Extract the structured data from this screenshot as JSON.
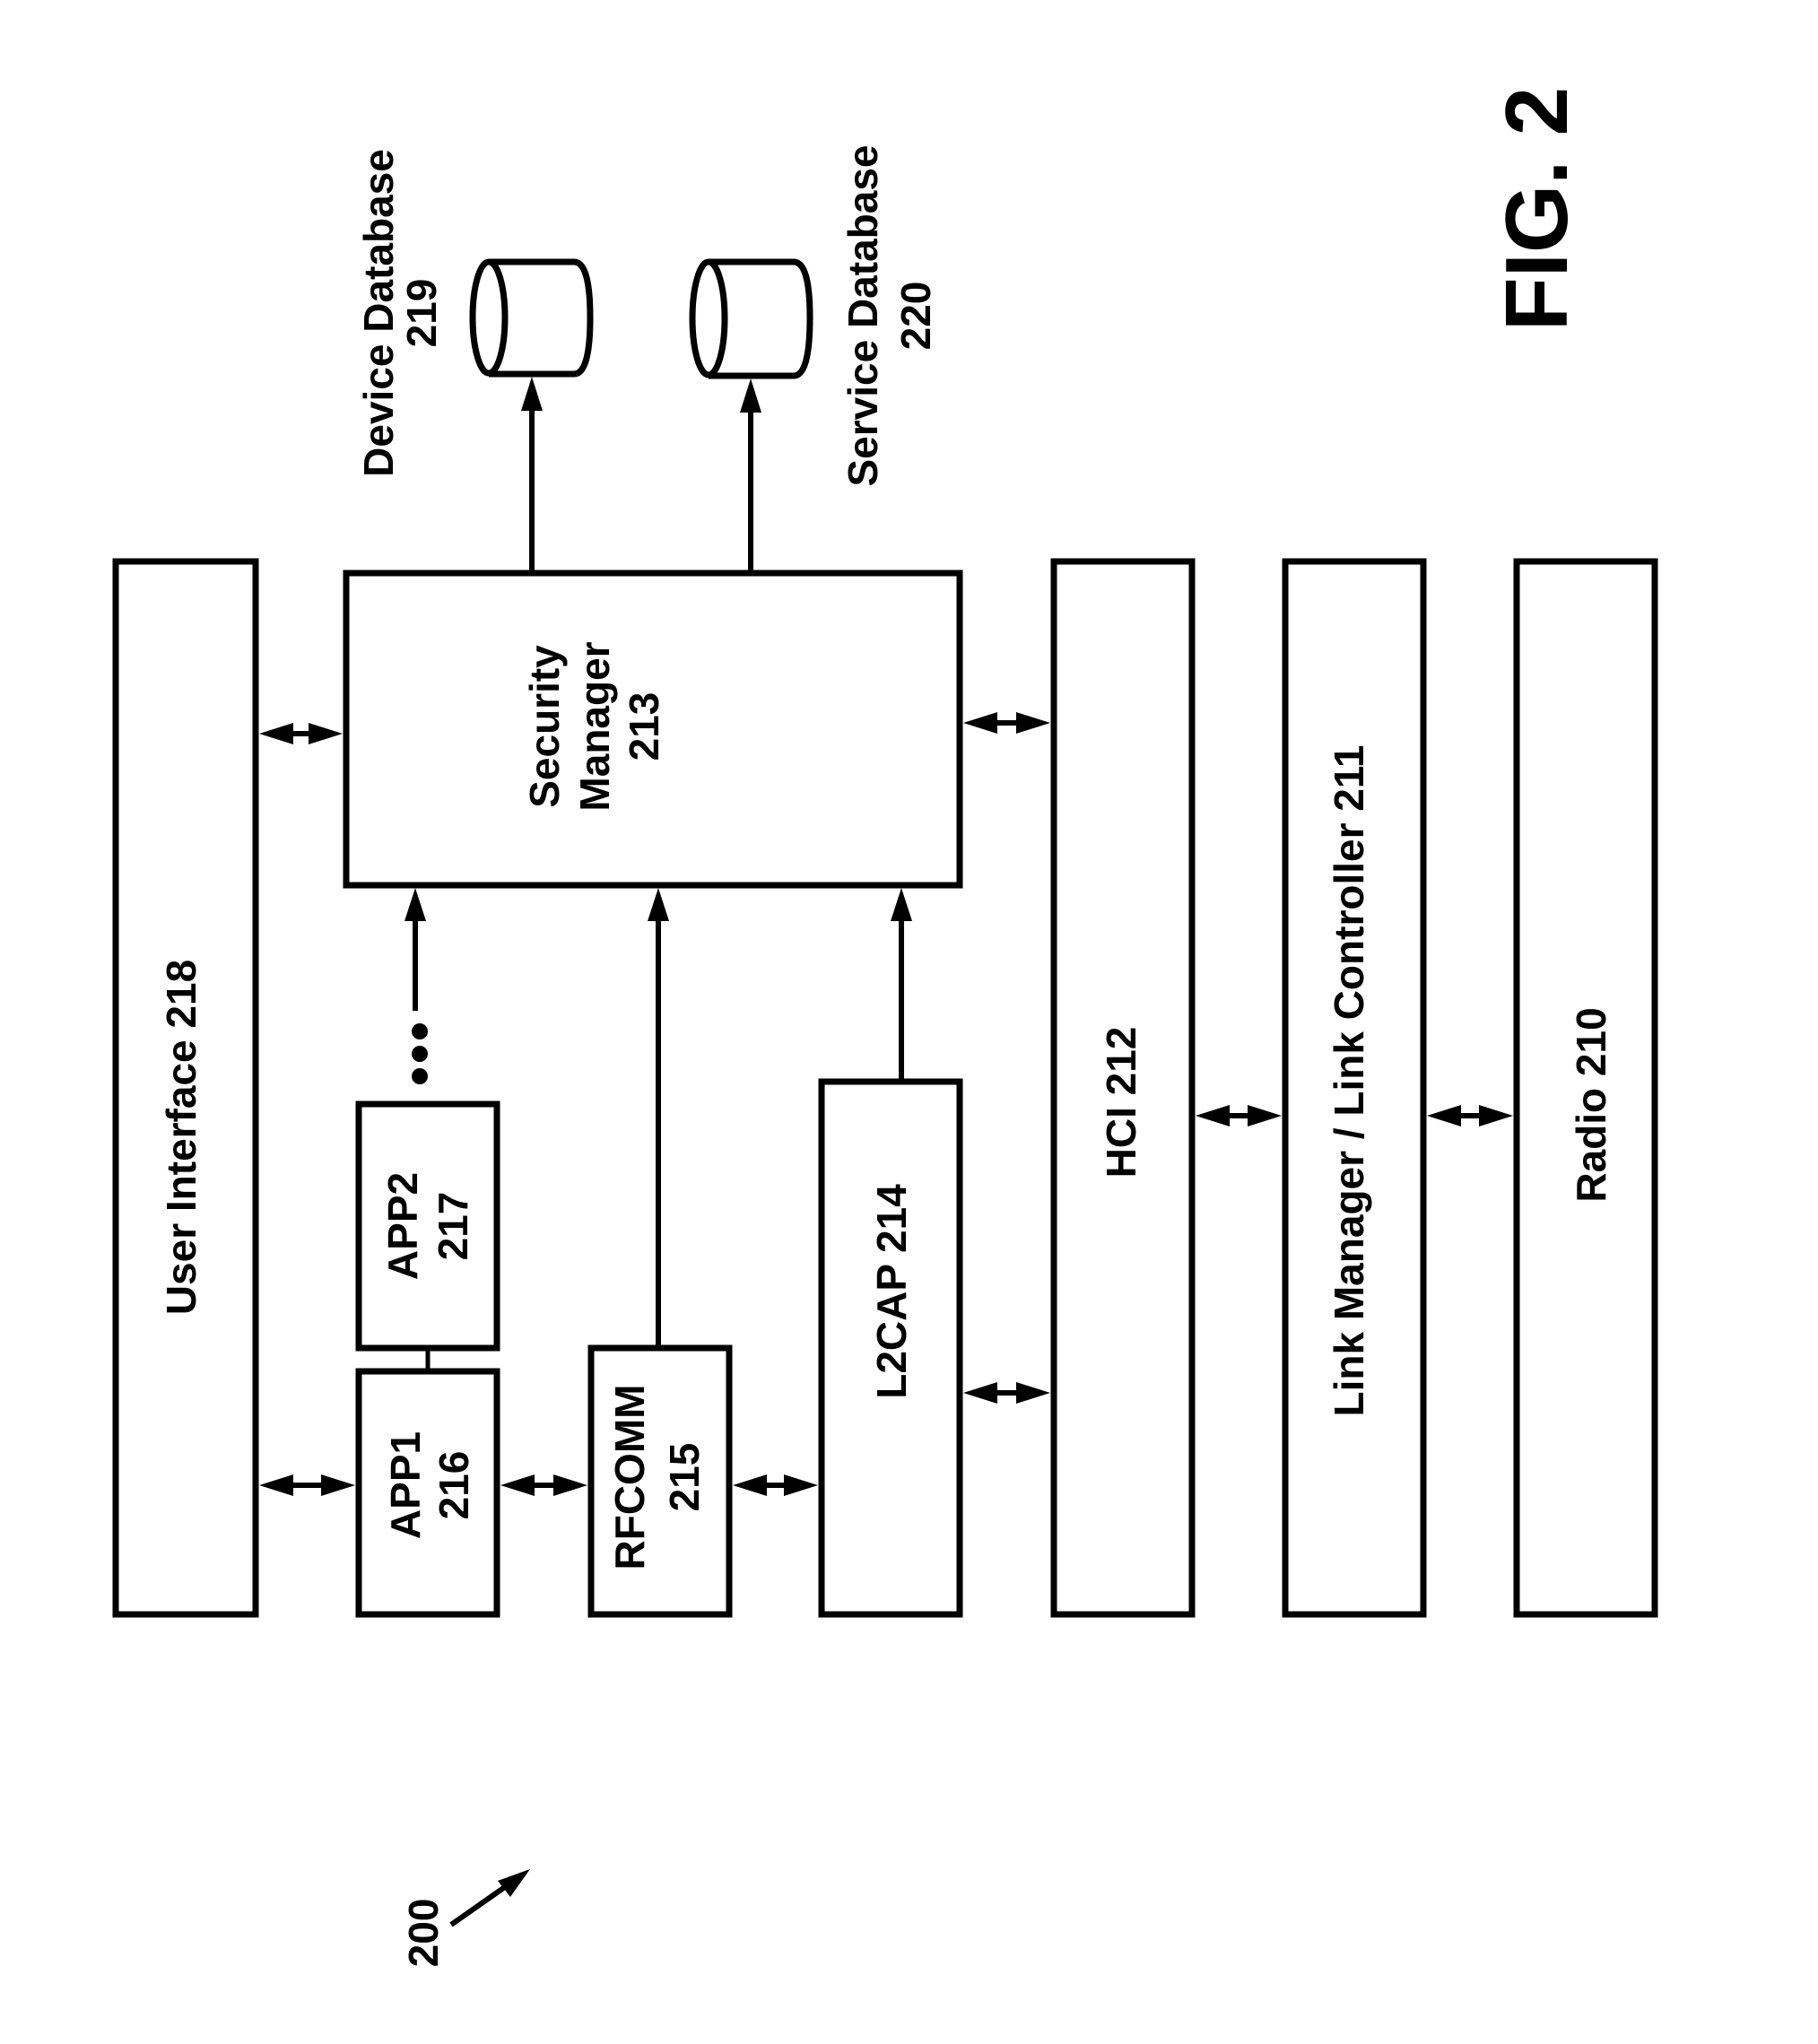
{
  "figure": {
    "title": "FIG. 2",
    "reference_number": "200"
  },
  "blocks": {
    "user_interface": {
      "name": "User Interface",
      "ref": "218",
      "label": "User Interface 218"
    },
    "security_manager": {
      "line1": "Security",
      "line2": "Manager",
      "line3": "213"
    },
    "app1": {
      "line1": "APP1",
      "line2": "216"
    },
    "app2": {
      "line1": "APP2",
      "line2": "217"
    },
    "rfcomm": {
      "line1": "RFCOMM",
      "line2": "215"
    },
    "l2cap": {
      "label": "L2CAP 214"
    },
    "hci": {
      "label": "HCI 212"
    },
    "link_manager": {
      "label": "Link Manager / Link Controller 211"
    },
    "radio": {
      "label": "Radio 210"
    }
  },
  "databases": {
    "device": {
      "line1": "Device Database",
      "line2": "219"
    },
    "service": {
      "line1": "Service Database",
      "line2": "220"
    }
  },
  "connections": [
    {
      "from": "user_interface",
      "to": "security_manager",
      "type": "bidirectional"
    },
    {
      "from": "user_interface",
      "to": "app1",
      "type": "bidirectional"
    },
    {
      "from": "app1",
      "to": "rfcomm",
      "type": "bidirectional"
    },
    {
      "from": "rfcomm",
      "to": "l2cap",
      "type": "bidirectional"
    },
    {
      "from": "l2cap",
      "to": "hci",
      "type": "bidirectional"
    },
    {
      "from": "security_manager",
      "to": "hci",
      "type": "bidirectional"
    },
    {
      "from": "hci",
      "to": "link_manager",
      "type": "bidirectional"
    },
    {
      "from": "link_manager",
      "to": "radio",
      "type": "bidirectional"
    },
    {
      "from": "apps",
      "to": "security_manager",
      "type": "directed"
    },
    {
      "from": "rfcomm",
      "to": "security_manager",
      "type": "directed"
    },
    {
      "from": "l2cap",
      "to": "security_manager",
      "type": "directed"
    },
    {
      "from": "security_manager",
      "to": "device_database",
      "type": "directed"
    },
    {
      "from": "security_manager",
      "to": "service_database",
      "type": "directed"
    },
    {
      "from": "app1",
      "to": "app2",
      "type": "line"
    }
  ],
  "ellipsis": "more applications (three dots)"
}
